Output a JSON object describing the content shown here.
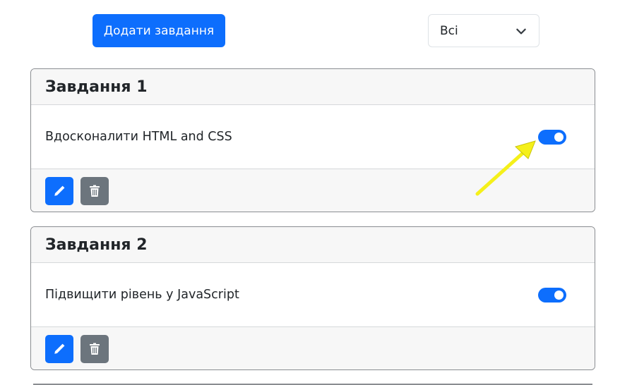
{
  "toolbar": {
    "add_label": "Додати завдання",
    "filter_value": "Всі"
  },
  "tasks": [
    {
      "title": "Завдання 1",
      "description": "Вдосконалити HTML and CSS",
      "toggle_on": true
    },
    {
      "title": "Завдання 2",
      "description": "Підвищити рівень у JavaScript",
      "toggle_on": true
    }
  ],
  "icons": {
    "edit": "pencil-icon",
    "delete": "trash-icon",
    "dropdown": "chevron-down-icon",
    "annotation": "arrow-annotation"
  },
  "colors": {
    "primary": "#0d6efd",
    "secondary": "#6c757d",
    "annotation_arrow": "#f5f01a"
  }
}
